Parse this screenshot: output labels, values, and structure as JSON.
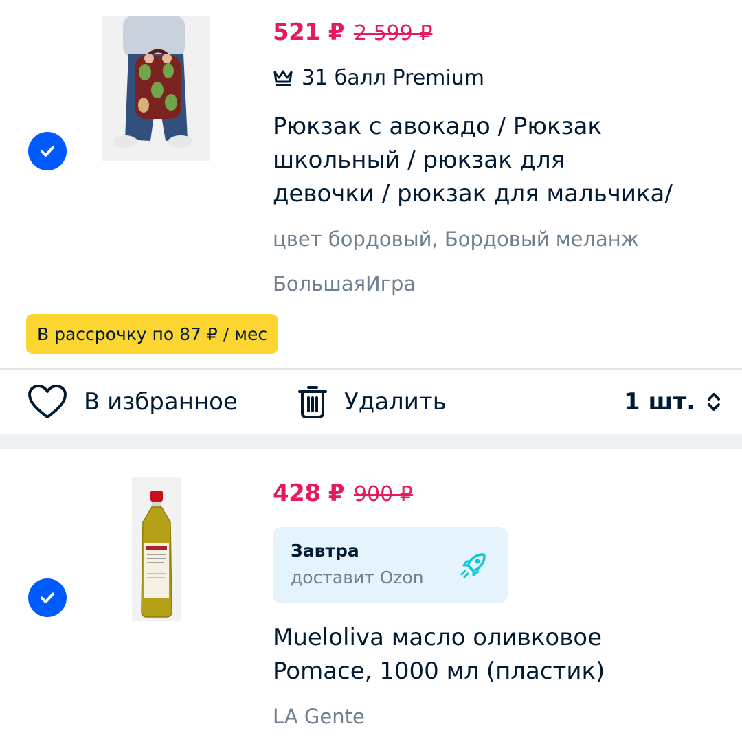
{
  "items": [
    {
      "price": "521 ₽",
      "old_price": "2 599 ₽",
      "bonus_text": "31 балл Premium",
      "title_lines": [
        "Рюкзак с авокадо / Рюкзак",
        "школьный / рюкзак для",
        "девочки / рюкзак для мальчика/"
      ],
      "color_text": "цвет бордовый, Бордовый меланж",
      "seller": "БольшаяИгра",
      "installment": "В рассрочку по 87 ₽ / мес",
      "checked": true
    },
    {
      "price": "428 ₽",
      "old_price": "900 ₽",
      "delivery_title": "Завтра",
      "delivery_sub": "доставит Ozon",
      "title_lines": [
        "Mueloliva масло оливковое",
        "Pomace, 1000 мл (пластик)"
      ],
      "seller": "LA Gente",
      "checked": true
    }
  ],
  "actions": {
    "favorite_label": "В избранное",
    "delete_label": "Удалить",
    "quantity_label": "1 шт."
  },
  "colors": {
    "accent_blue": "#005bff",
    "price_pink": "#e5195f",
    "installment_yellow": "#fcd531",
    "text_dark": "#001a34",
    "text_gray": "#707f8d"
  }
}
